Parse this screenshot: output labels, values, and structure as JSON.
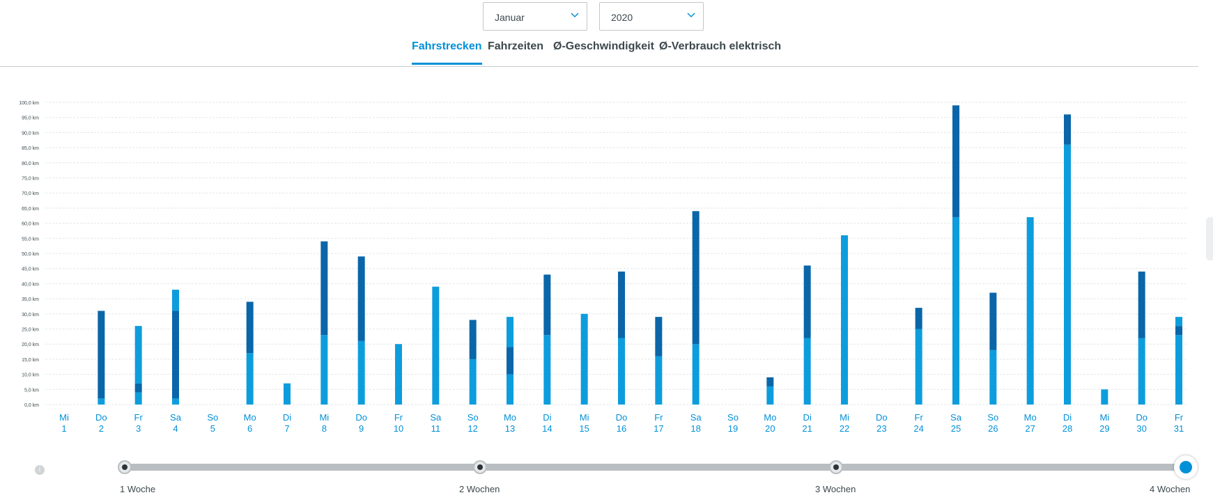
{
  "filters": {
    "month": {
      "value": "Januar",
      "icon": "chevron-down-icon"
    },
    "year": {
      "value": "2020",
      "icon": "chevron-down-icon"
    }
  },
  "tabs": [
    {
      "label": "Fahrstrecken",
      "active": true
    },
    {
      "label": "Fahrzeiten",
      "active": false
    },
    {
      "label": "Ø-Geschwindigkeit",
      "active": false
    },
    {
      "label": "Ø-Verbrauch elektrisch",
      "active": false
    }
  ],
  "colors": {
    "accent": "#0090d8",
    "bar_light": "#0d9ddd",
    "bar_dark": "#0a66a8",
    "text": "#3c484d",
    "grid": "#e3e6e8",
    "track": "#b8bec1"
  },
  "chart_data": {
    "type": "bar",
    "stacked": true,
    "grid": true,
    "ylim": [
      0,
      100
    ],
    "ytick_step": 5,
    "yticks": [
      "0,0 km",
      "5,0 km",
      "10,0 km",
      "15,0 km",
      "20,0 km",
      "25,0 km",
      "30,0 km",
      "35,0 km",
      "40,0 km",
      "45,0 km",
      "50,0 km",
      "55,0 km",
      "60,0 km",
      "65,0 km",
      "70,0 km",
      "75,0 km",
      "80,0 km",
      "85,0 km",
      "90,0 km",
      "95,0 km",
      "100,0 km"
    ],
    "categories": [
      {
        "weekday": "Mi",
        "day": "1"
      },
      {
        "weekday": "Do",
        "day": "2"
      },
      {
        "weekday": "Fr",
        "day": "3"
      },
      {
        "weekday": "Sa",
        "day": "4"
      },
      {
        "weekday": "So",
        "day": "5"
      },
      {
        "weekday": "Mo",
        "day": "6"
      },
      {
        "weekday": "Di",
        "day": "7"
      },
      {
        "weekday": "Mi",
        "day": "8"
      },
      {
        "weekday": "Do",
        "day": "9"
      },
      {
        "weekday": "Fr",
        "day": "10"
      },
      {
        "weekday": "Sa",
        "day": "11"
      },
      {
        "weekday": "So",
        "day": "12"
      },
      {
        "weekday": "Mo",
        "day": "13"
      },
      {
        "weekday": "Di",
        "day": "14"
      },
      {
        "weekday": "Mi",
        "day": "15"
      },
      {
        "weekday": "Do",
        "day": "16"
      },
      {
        "weekday": "Fr",
        "day": "17"
      },
      {
        "weekday": "Sa",
        "day": "18"
      },
      {
        "weekday": "So",
        "day": "19"
      },
      {
        "weekday": "Mo",
        "day": "20"
      },
      {
        "weekday": "Di",
        "day": "21"
      },
      {
        "weekday": "Mi",
        "day": "22"
      },
      {
        "weekday": "Do",
        "day": "23"
      },
      {
        "weekday": "Fr",
        "day": "24"
      },
      {
        "weekday": "Sa",
        "day": "25"
      },
      {
        "weekday": "So",
        "day": "26"
      },
      {
        "weekday": "Mo",
        "day": "27"
      },
      {
        "weekday": "Di",
        "day": "28"
      },
      {
        "weekday": "Mi",
        "day": "29"
      },
      {
        "weekday": "Do",
        "day": "30"
      },
      {
        "weekday": "Fr",
        "day": "31"
      }
    ],
    "trips": [
      [],
      [
        {
          "km": 2,
          "tone": "light"
        },
        {
          "km": 29,
          "tone": "dark"
        }
      ],
      [
        {
          "km": 4,
          "tone": "light"
        },
        {
          "km": 3,
          "tone": "dark"
        },
        {
          "km": 19,
          "tone": "light"
        }
      ],
      [
        {
          "km": 2,
          "tone": "light"
        },
        {
          "km": 29,
          "tone": "dark"
        },
        {
          "km": 7,
          "tone": "light"
        }
      ],
      [],
      [
        {
          "km": 17,
          "tone": "light"
        },
        {
          "km": 17,
          "tone": "dark"
        }
      ],
      [
        {
          "km": 7,
          "tone": "light"
        }
      ],
      [
        {
          "km": 23,
          "tone": "light"
        },
        {
          "km": 31,
          "tone": "dark"
        }
      ],
      [
        {
          "km": 21,
          "tone": "light"
        },
        {
          "km": 28,
          "tone": "dark"
        }
      ],
      [
        {
          "km": 20,
          "tone": "light"
        }
      ],
      [
        {
          "km": 39,
          "tone": "light"
        }
      ],
      [
        {
          "km": 15,
          "tone": "light"
        },
        {
          "km": 13,
          "tone": "dark"
        }
      ],
      [
        {
          "km": 10,
          "tone": "light"
        },
        {
          "km": 9,
          "tone": "dark"
        },
        {
          "km": 10,
          "tone": "light"
        }
      ],
      [
        {
          "km": 23,
          "tone": "light"
        },
        {
          "km": 20,
          "tone": "dark"
        }
      ],
      [
        {
          "km": 30,
          "tone": "light"
        }
      ],
      [
        {
          "km": 22,
          "tone": "light"
        },
        {
          "km": 22,
          "tone": "dark"
        }
      ],
      [
        {
          "km": 16,
          "tone": "light"
        },
        {
          "km": 13,
          "tone": "dark"
        }
      ],
      [
        {
          "km": 20,
          "tone": "light"
        },
        {
          "km": 44,
          "tone": "dark"
        }
      ],
      [],
      [
        {
          "km": 6,
          "tone": "light"
        },
        {
          "km": 3,
          "tone": "dark"
        }
      ],
      [
        {
          "km": 22,
          "tone": "light"
        },
        {
          "km": 24,
          "tone": "dark"
        }
      ],
      [
        {
          "km": 56,
          "tone": "light"
        }
      ],
      [],
      [
        {
          "km": 25,
          "tone": "light"
        },
        {
          "km": 7,
          "tone": "dark"
        }
      ],
      [
        {
          "km": 62,
          "tone": "light"
        },
        {
          "km": 37,
          "tone": "dark"
        }
      ],
      [
        {
          "km": 18,
          "tone": "light"
        },
        {
          "km": 19,
          "tone": "dark"
        }
      ],
      [
        {
          "km": 62,
          "tone": "light"
        }
      ],
      [
        {
          "km": 86,
          "tone": "light"
        },
        {
          "km": 10,
          "tone": "dark"
        }
      ],
      [
        {
          "km": 5,
          "tone": "light"
        }
      ],
      [
        {
          "km": 22,
          "tone": "light"
        },
        {
          "km": 22,
          "tone": "dark"
        }
      ],
      [
        {
          "km": 23,
          "tone": "light"
        },
        {
          "km": 3,
          "tone": "dark"
        },
        {
          "km": 3,
          "tone": "light"
        }
      ]
    ]
  },
  "timeline": {
    "labels": [
      "1 Woche",
      "2 Wochen",
      "3 Wochen",
      "4 Wochen"
    ],
    "selected_index": 3,
    "info_icon": "info-icon",
    "info_text": "i"
  }
}
